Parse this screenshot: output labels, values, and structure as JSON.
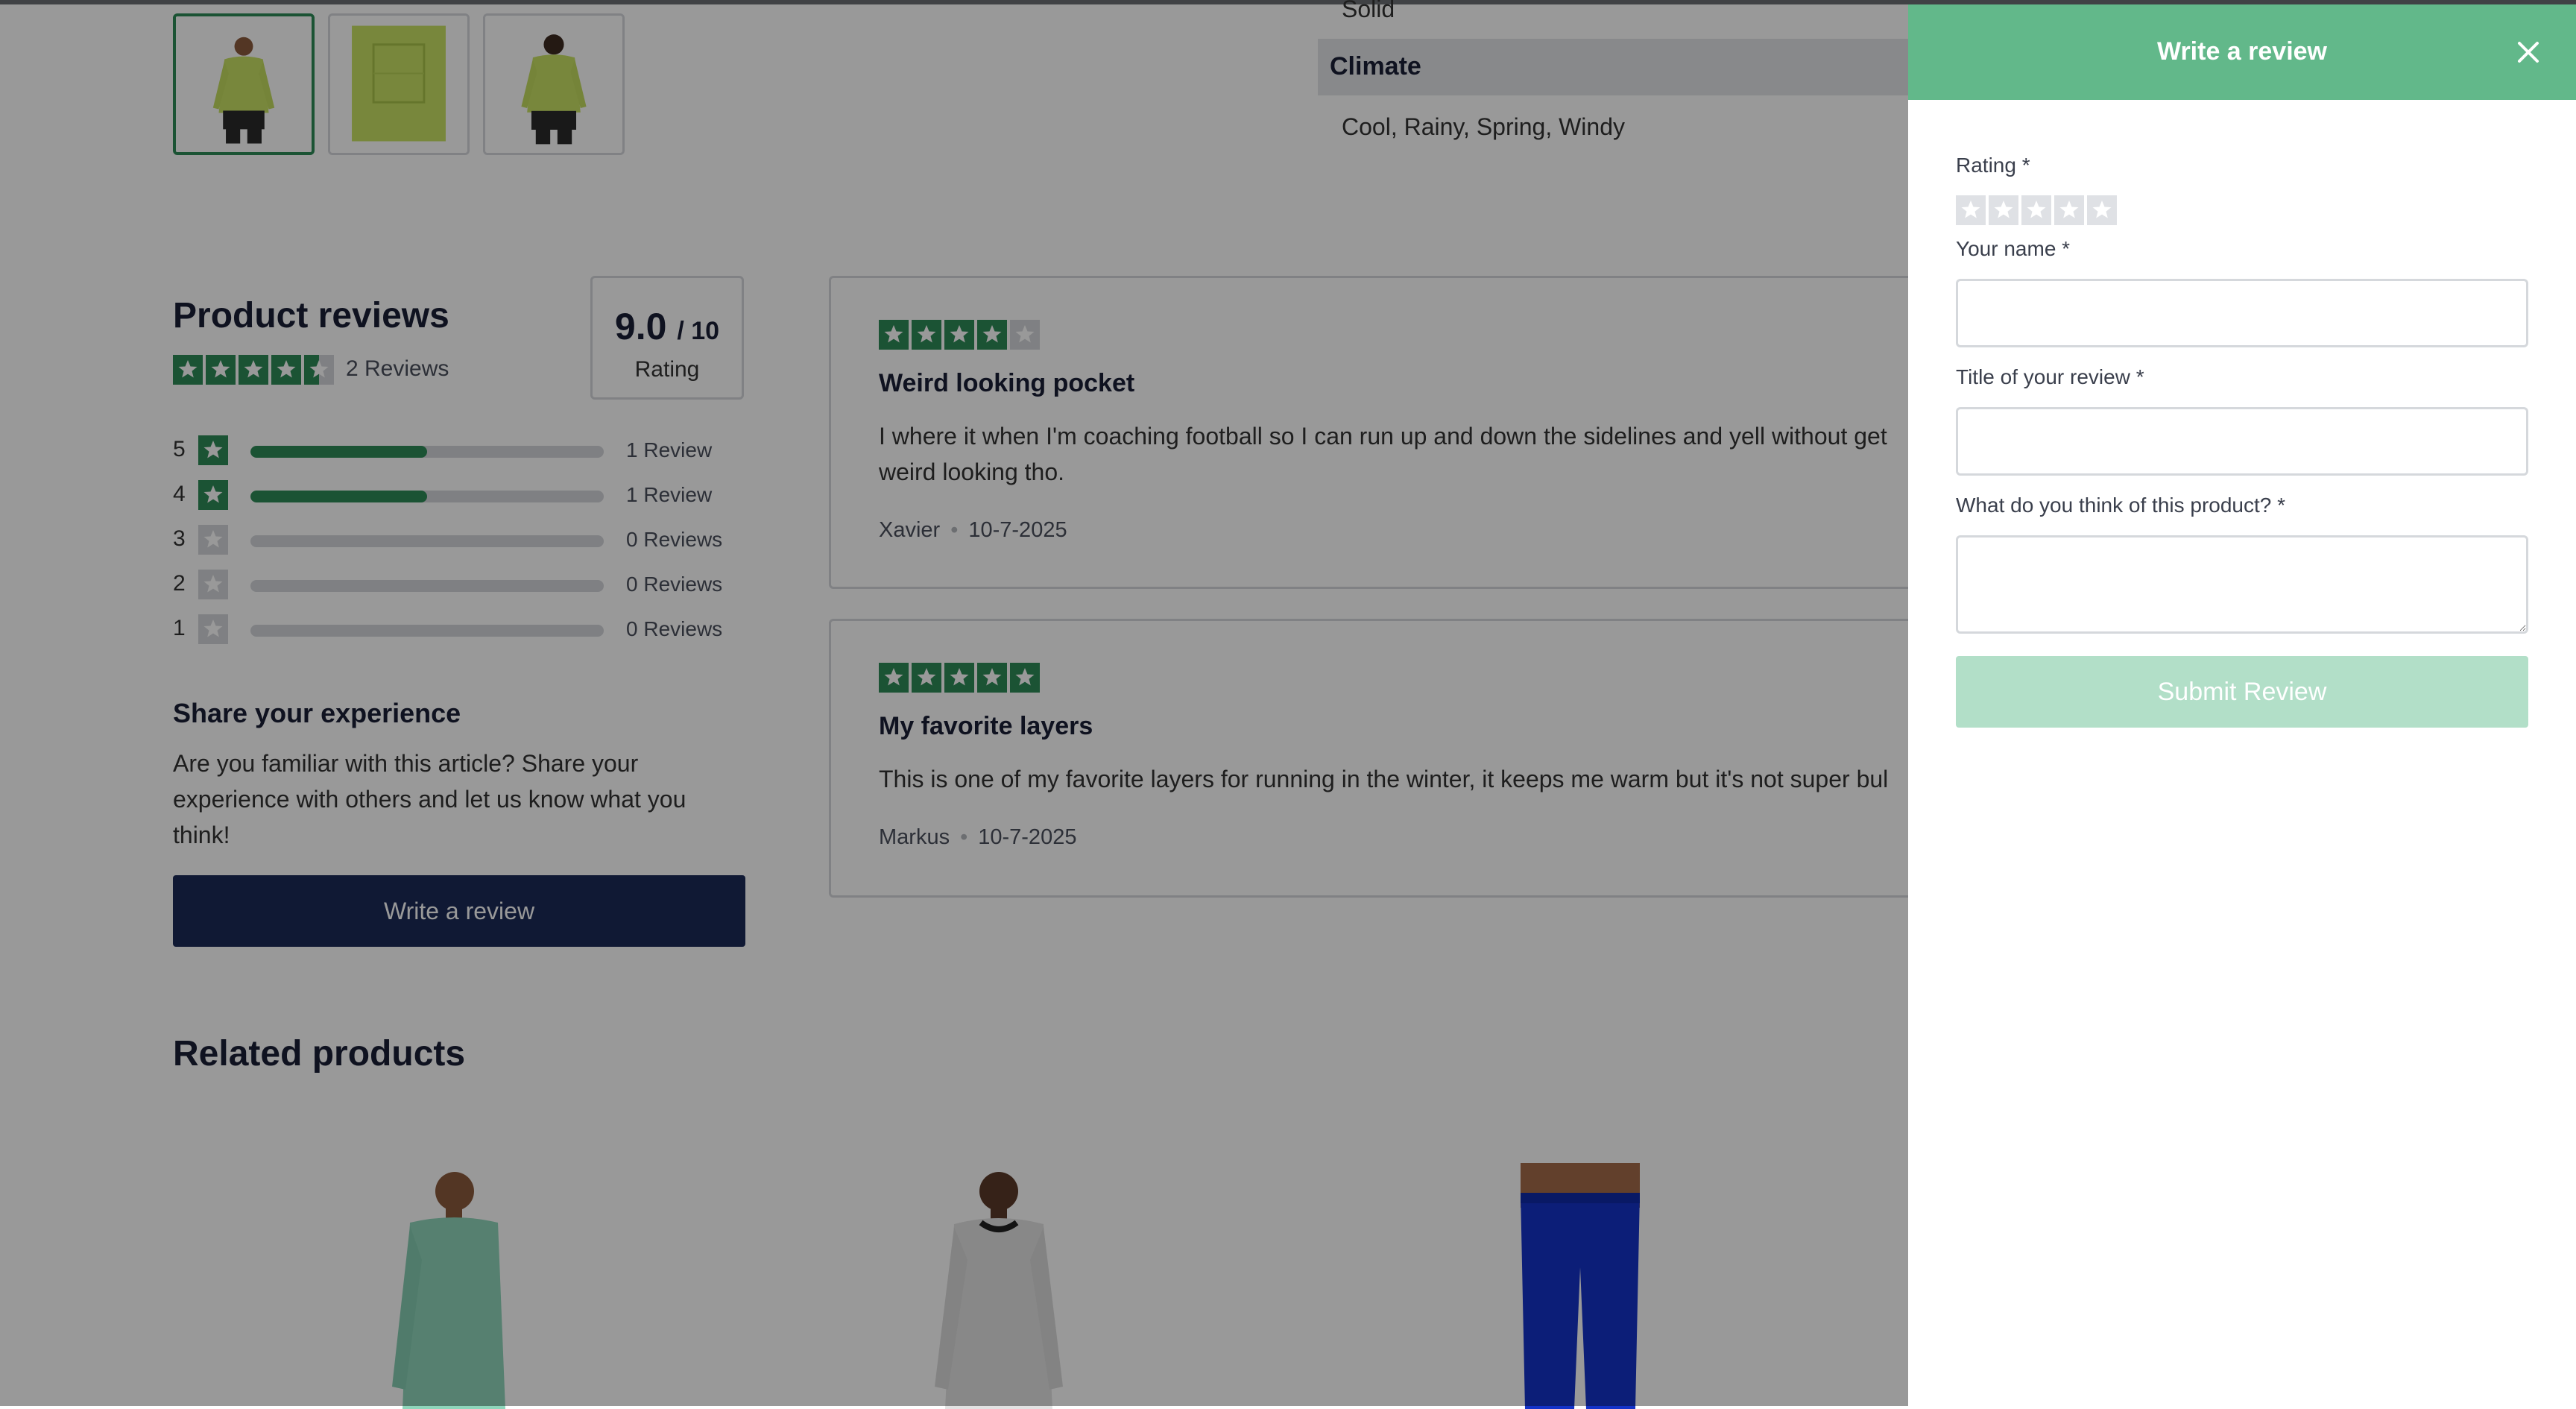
{
  "product": {
    "thumbnails": [
      "thumb-front",
      "thumb-fabric",
      "thumb-back"
    ],
    "specs": {
      "prev_value": "Solid",
      "climate_label": "Climate",
      "climate_value": "Cool, Rainy, Spring, Windy"
    }
  },
  "reviews_summary": {
    "title": "Product reviews",
    "average_stars": 4.5,
    "count_label": "2 Reviews",
    "score": "9.0",
    "score_max": "/ 10",
    "score_label": "Rating",
    "distribution": [
      {
        "stars": "5",
        "fraction": 0.5,
        "label": "1 Review"
      },
      {
        "stars": "4",
        "fraction": 0.5,
        "label": "1 Review"
      },
      {
        "stars": "3",
        "fraction": 0,
        "label": "0 Reviews"
      },
      {
        "stars": "2",
        "fraction": 0,
        "label": "0 Reviews"
      },
      {
        "stars": "1",
        "fraction": 0,
        "label": "0 Reviews"
      }
    ],
    "share_title": "Share your experience",
    "share_text": "Are you familiar with this article? Share your experience with others and let us know what you think!",
    "write_button": "Write a review"
  },
  "reviews": [
    {
      "stars": 4,
      "title": "Weird looking pocket",
      "body": "I where it when I'm coaching football so I can run up and down the sidelines and yell without get",
      "body_line2": "weird looking tho.",
      "author": "Xavier",
      "date": "10-7-2025"
    },
    {
      "stars": 5,
      "title": "My favorite layers",
      "body": "This is one of my favorite layers for running in the winter, it keeps me warm but it's not super bul",
      "author": "Markus",
      "date": "10-7-2025"
    }
  ],
  "related": {
    "title": "Related products"
  },
  "drawer": {
    "title": "Write a review",
    "close_icon": "close-icon",
    "rating_label": "Rating *",
    "rating_value": 0,
    "name_label": "Your name *",
    "name_value": "",
    "review_title_label": "Title of your review *",
    "review_title_value": "",
    "opinion_label": "What do you think of this product? *",
    "opinion_value": "",
    "submit_label": "Submit Review"
  },
  "colors": {
    "accent_green": "#2e8b57",
    "drawer_header": "#62b88a",
    "submit_disabled": "#b2dfc8",
    "navy_button": "#1b2a57"
  }
}
